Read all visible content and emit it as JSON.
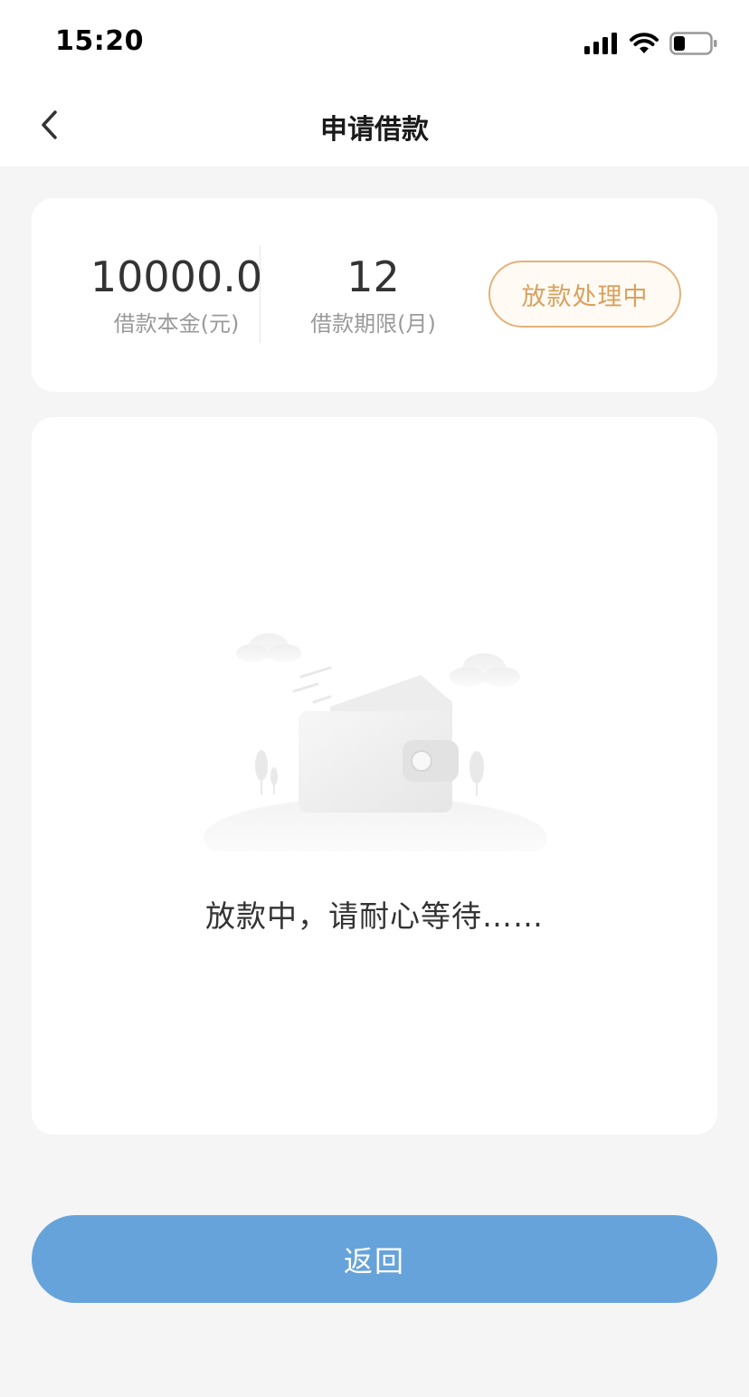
{
  "status_bar": {
    "time": "15:20"
  },
  "nav": {
    "title": "申请借款"
  },
  "summary": {
    "amount_value": "10000.0",
    "amount_label": "借款本金(元)",
    "term_value": "12",
    "term_label": "借款期限(月)",
    "status_badge": "放款处理中"
  },
  "main": {
    "message": "放款中，请耐心等待……"
  },
  "footer": {
    "return_button": "返回"
  },
  "colors": {
    "accent_blue": "#66a3da",
    "badge_gold": "#d9a15e",
    "background": "#f5f5f5"
  },
  "icons": {
    "back": "chevron-left-icon",
    "signal": "signal-icon",
    "wifi": "wifi-icon",
    "battery": "battery-icon",
    "illustration": "wallet-illustration"
  }
}
